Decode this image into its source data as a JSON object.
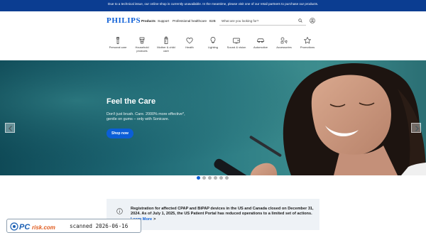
{
  "banner": {
    "text": "Due to a technical issue, our online shop is currently unavailable. In the meantime, please visit one of our retail partners to purchase our products."
  },
  "header": {
    "logo": "PHILIPS",
    "nav": [
      "Products",
      "Support",
      "Professional healthcare",
      "B2B"
    ],
    "search_placeholder": "What are you looking for?"
  },
  "categories": [
    {
      "label": "Personal care",
      "icon": "personal-care-icon"
    },
    {
      "label": "Household products",
      "icon": "household-icon"
    },
    {
      "label": "Mother & child care",
      "icon": "baby-bottle-icon"
    },
    {
      "label": "Health",
      "icon": "heart-icon"
    },
    {
      "label": "Lighting",
      "icon": "bulb-icon"
    },
    {
      "label": "Sound & vision",
      "icon": "tv-icon"
    },
    {
      "label": "Automotive",
      "icon": "car-icon"
    },
    {
      "label": "Accessories",
      "icon": "accessories-icon"
    },
    {
      "label": "Promotions",
      "icon": "star-icon"
    }
  ],
  "hero": {
    "title": "Feel the Care",
    "subtitle": "Don't just brush. Care. 2000% more effective*, gentle on gums – only with Sonicare.",
    "cta": "Shop now",
    "slides": 6,
    "active_slide": 0
  },
  "notice": {
    "text": "Registration for affected CPAP and BiPAP devices in the US and Canada closed on December 31, 2024. As of July 1, 2025, the US Patient Portal has reduced operations to a limited set of actions.",
    "link": "Learn More",
    "link_chevron": ">"
  },
  "watermark": {
    "brand": "PCrisk.com",
    "stamp": "scanned 2026-06-16"
  },
  "colors": {
    "brand_blue": "#0b5ed7",
    "banner_blue": "#0b3d91",
    "notice_bg": "#eef2f6"
  }
}
